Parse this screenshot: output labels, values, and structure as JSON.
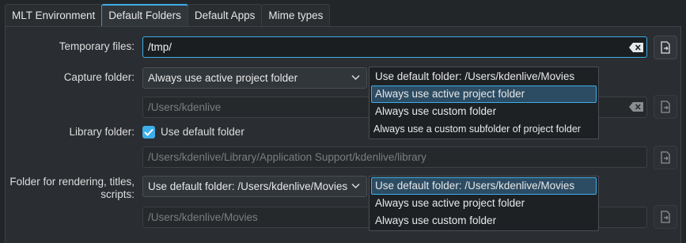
{
  "tabs": [
    {
      "label": "MLT Environment"
    },
    {
      "label": "Default Folders"
    },
    {
      "label": "Default Apps"
    },
    {
      "label": "Mime types"
    }
  ],
  "temporary": {
    "label": "Temporary files:",
    "value": "/tmp/"
  },
  "capture": {
    "label": "Capture folder:",
    "combo_value": "Always use active project folder",
    "path_placeholder": "/Users/kdenlive",
    "options": [
      "Use default folder: /Users/kdenlive/Movies",
      "Always use active project folder",
      "Always use custom folder",
      "Always use a custom subfolder of project folder"
    ]
  },
  "library": {
    "label": "Library folder:",
    "checkbox_label": "Use default folder",
    "checked": true,
    "path": "/Users/kdenlive/Library/Application Support/kdenlive/library"
  },
  "rendering": {
    "label_line1": "Folder for rendering, titles,",
    "label_line2": "scripts:",
    "combo_value": "Use default folder: /Users/kdenlive/Movies",
    "path": "/Users/kdenlive/Movies",
    "options": [
      "Use default folder: /Users/kdenlive/Movies",
      "Always use active project folder",
      "Always use custom folder"
    ]
  },
  "icons": {
    "clear": "clear-text-icon",
    "browse": "document-open-icon",
    "dropdown": "chevron-down-icon",
    "check": "checkmark-icon"
  },
  "colors": {
    "accent": "#3daee9",
    "background": "#232629"
  }
}
